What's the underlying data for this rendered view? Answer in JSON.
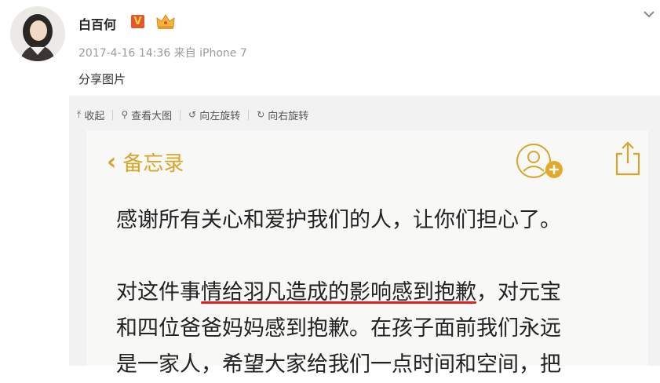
{
  "post": {
    "username": "白百何",
    "vip_badge": "V",
    "timestamp": "2017-4-16 14:36",
    "source": "来自 iPhone 7",
    "text": "分享图片"
  },
  "toolbar": {
    "collapse": "收起",
    "view_large": "查看大图",
    "rotate_left": "向左旋转",
    "rotate_right": "向右旋转"
  },
  "memo": {
    "back_label": "备忘录",
    "line1": "感谢所有关心和爱护我们的人，让你们担心了。",
    "line2_pre": "对这件事",
    "line2_highlight": "情给羽凡造成的影响感到抱歉",
    "line2_post": "，对元宝",
    "line3": "和四位爸爸妈妈感到抱歉。在孩子面前我们永远",
    "line4": "是一家人，希望大家给我们一点时间和空间，把"
  },
  "colors": {
    "accent_gold": "#d7a52a",
    "underline_red": "#e02020",
    "badge_orange": "#e2572c"
  }
}
